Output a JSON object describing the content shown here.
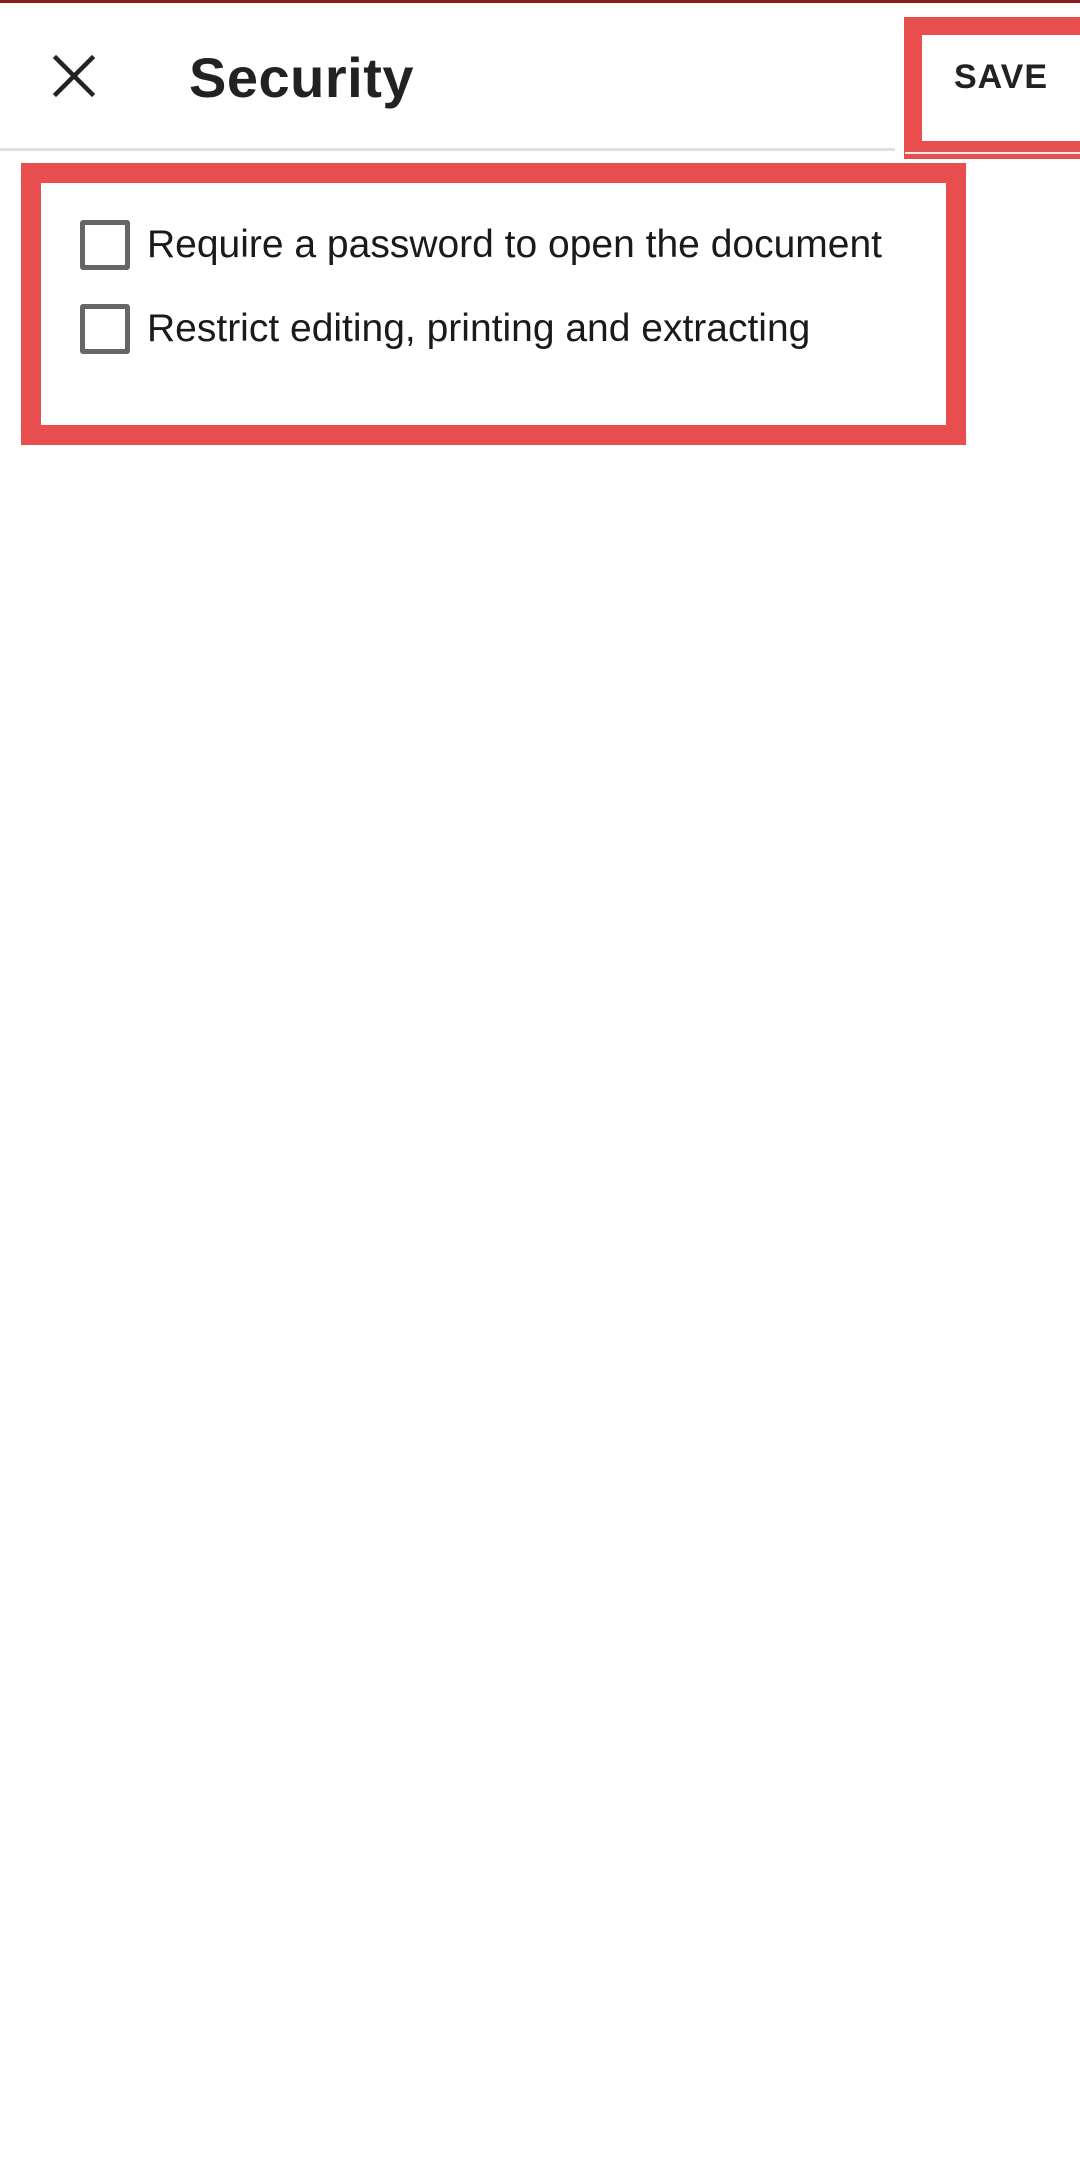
{
  "header": {
    "close_icon": "close-icon",
    "title": "Security",
    "save_label": "SAVE"
  },
  "options": [
    {
      "label": "Require a password to open the document",
      "checked": false
    },
    {
      "label": "Restrict editing, printing and extracting",
      "checked": false
    }
  ],
  "colors": {
    "highlight": "#e94e4f",
    "top_accent": "#8b1c1c",
    "text": "#222222",
    "checkbox_border": "#666666"
  }
}
